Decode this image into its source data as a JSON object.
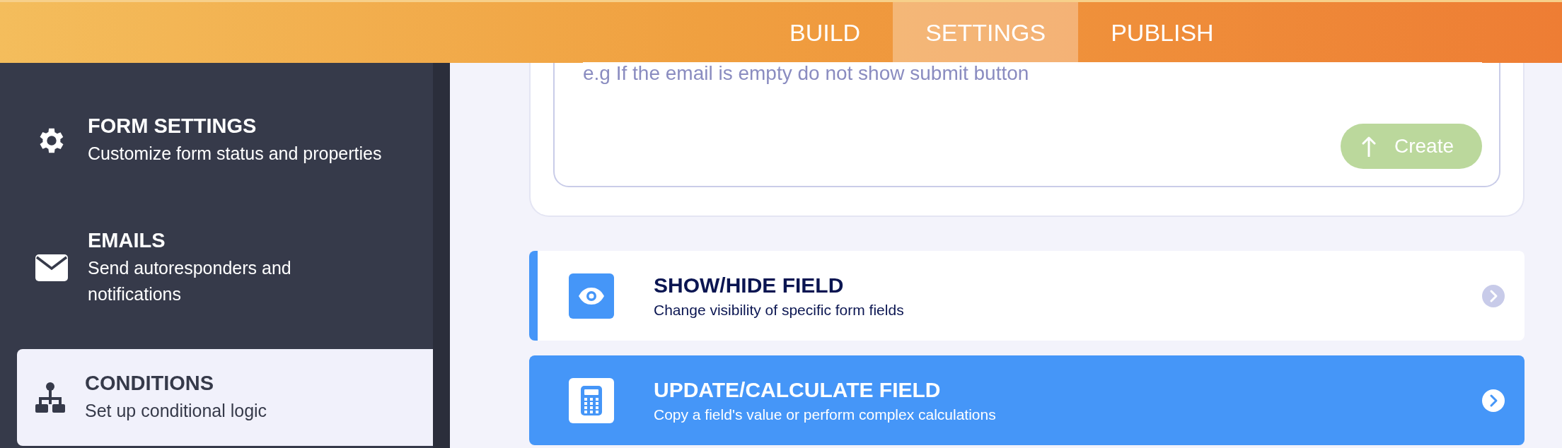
{
  "top_nav": {
    "tabs": [
      {
        "label": "BUILD",
        "selected": false
      },
      {
        "label": "SETTINGS",
        "selected": true
      },
      {
        "label": "PUBLISH",
        "selected": false
      }
    ]
  },
  "sidebar": {
    "items": [
      {
        "kind": "gear",
        "title": "FORM SETTINGS",
        "subtitle": "Customize form status and properties",
        "selected": false
      },
      {
        "kind": "mail",
        "title": "EMAILS",
        "subtitle": "Send autoresponders and notifications",
        "selected": false
      },
      {
        "kind": "tree",
        "title": "CONDITIONS",
        "subtitle": "Set up conditional logic",
        "selected": true
      }
    ]
  },
  "condition_input": {
    "placeholder": "e.g If the email is empty do not show submit button",
    "button": {
      "label": "Create",
      "disabled": true
    }
  },
  "condition_types": [
    {
      "kind": "eye",
      "title": "SHOW/HIDE FIELD",
      "subtitle": "Change visibility of specific form fields",
      "selected": false
    },
    {
      "kind": "calculator",
      "title": "UPDATE/CALCULATE FIELD",
      "subtitle": "Copy a field's value or perform complex calculations",
      "selected": true
    }
  ]
}
